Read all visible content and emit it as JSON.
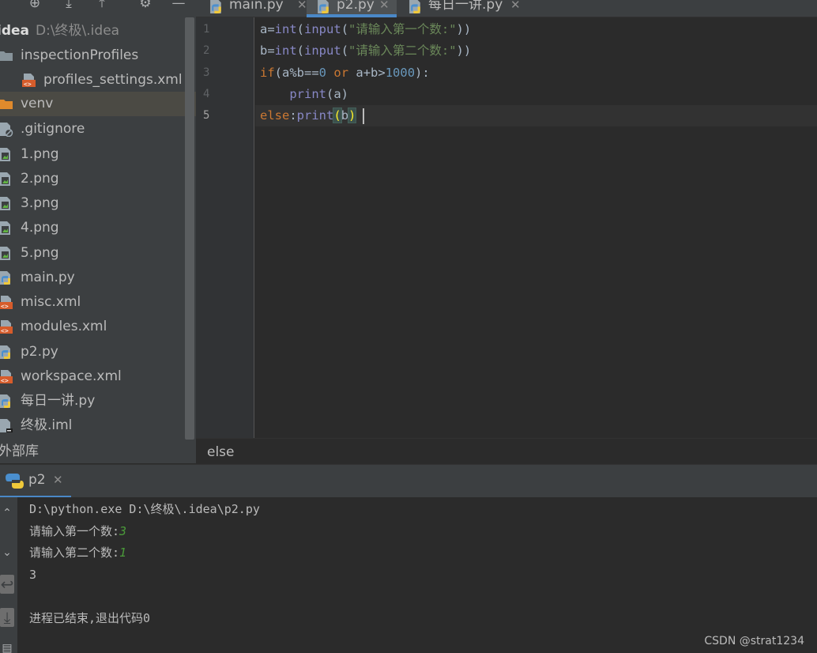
{
  "project": {
    "root_name": "idea",
    "root_path": "D:\\终极\\.idea",
    "items": [
      {
        "label": "inspectionProfiles",
        "icon": "folder-icon"
      },
      {
        "label": "profiles_settings.xml",
        "icon": "xml-file-icon"
      },
      {
        "label": "venv",
        "icon": "folder-icon"
      },
      {
        "label": ".gitignore",
        "icon": "ignored-file-icon"
      },
      {
        "label": "1.png",
        "icon": "image-file-icon"
      },
      {
        "label": "2.png",
        "icon": "image-file-icon"
      },
      {
        "label": "3.png",
        "icon": "image-file-icon"
      },
      {
        "label": "4.png",
        "icon": "image-file-icon"
      },
      {
        "label": "5.png",
        "icon": "image-file-icon"
      },
      {
        "label": "main.py",
        "icon": "python-file-icon"
      },
      {
        "label": "misc.xml",
        "icon": "xml-file-icon"
      },
      {
        "label": "modules.xml",
        "icon": "xml-file-icon"
      },
      {
        "label": "p2.py",
        "icon": "python-file-icon"
      },
      {
        "label": "workspace.xml",
        "icon": "xml-file-icon"
      },
      {
        "label": "每日一讲.py",
        "icon": "python-file-icon"
      },
      {
        "label": "终极.iml",
        "icon": "module-file-icon"
      }
    ],
    "external_libraries": "外部库"
  },
  "tabs": [
    {
      "label": "main.py",
      "close": "✕"
    },
    {
      "label": "p2.py",
      "close": "✕"
    },
    {
      "label": "每日一讲.py",
      "close": "✕"
    }
  ],
  "editor": {
    "line_numbers": [
      "1",
      "2",
      "3",
      "4",
      "5"
    ],
    "lines": [
      [
        {
          "t": "a=",
          "c": "pr"
        },
        {
          "t": "int",
          "c": "bi"
        },
        {
          "t": "(",
          "c": "pr"
        },
        {
          "t": "input",
          "c": "bi"
        },
        {
          "t": "(",
          "c": "pr"
        },
        {
          "t": "\"请输入第一个数:\"",
          "c": "st"
        },
        {
          "t": "))",
          "c": "pr"
        }
      ],
      [
        {
          "t": "b=",
          "c": "pr"
        },
        {
          "t": "int",
          "c": "bi"
        },
        {
          "t": "(",
          "c": "pr"
        },
        {
          "t": "input",
          "c": "bi"
        },
        {
          "t": "(",
          "c": "pr"
        },
        {
          "t": "\"请输入第二个数:\"",
          "c": "st"
        },
        {
          "t": "))",
          "c": "pr"
        }
      ],
      [
        {
          "t": "if",
          "c": "kw"
        },
        {
          "t": "(a%b==",
          "c": "pr"
        },
        {
          "t": "0",
          "c": "nm"
        },
        {
          "t": " ",
          "c": "pr"
        },
        {
          "t": "or",
          "c": "kw"
        },
        {
          "t": " a+b>",
          "c": "pr"
        },
        {
          "t": "1000",
          "c": "nm"
        },
        {
          "t": "):",
          "c": "pr"
        }
      ],
      [
        {
          "t": "    ",
          "c": "pr"
        },
        {
          "t": "print",
          "c": "bi"
        },
        {
          "t": "(a)",
          "c": "pr"
        }
      ],
      [
        {
          "t": "else",
          "c": "kw"
        },
        {
          "t": ":",
          "c": "pr"
        },
        {
          "t": "print",
          "c": "bi"
        },
        {
          "t": "(",
          "c": "mb"
        },
        {
          "t": "b",
          "c": "pr"
        },
        {
          "t": ")",
          "c": "mb"
        }
      ]
    ],
    "breadcrumb": "else"
  },
  "run": {
    "tab_label": "p2",
    "tab_close": "✕",
    "console": [
      {
        "text": "D:\\python.exe D:\\终极\\.idea\\p2.py",
        "input": ""
      },
      {
        "text": "请输入第一个数:",
        "input": "3"
      },
      {
        "text": "请输入第二个数:",
        "input": "1"
      },
      {
        "text": "3",
        "input": ""
      },
      {
        "text": "",
        "input": ""
      },
      {
        "text": "进程已结束,退出代码0",
        "input": ""
      }
    ]
  },
  "watermark": "CSDN @strat1234",
  "colors": {
    "keyword": "#cc7832",
    "builtin": "#8888c6",
    "string": "#6a8759",
    "number": "#6897bb",
    "console_input": "#4b9b3a",
    "active_tab_underline": "#4a88c7"
  }
}
